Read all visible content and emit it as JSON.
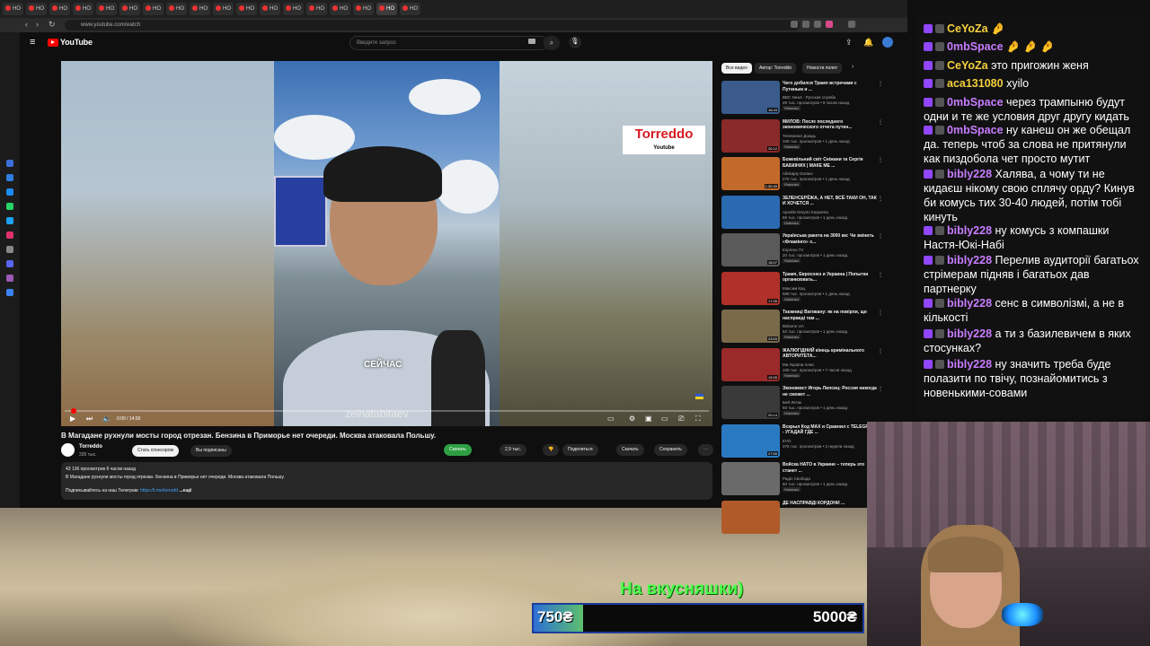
{
  "browser": {
    "tabs": [
      "НО",
      "НО",
      "НО",
      "НО",
      "НО",
      "НО",
      "НО",
      "НО",
      "НО",
      "НО",
      "НО",
      "НО",
      "НО",
      "НО",
      "НО",
      "НО",
      "НО",
      "НО"
    ],
    "url": "www.youtube.com/watch"
  },
  "youtube": {
    "logo": "YouTube",
    "search_placeholder": "Введите запрос",
    "video": {
      "caption": "СЕЙЧАС",
      "watermark": "zeinatabitaev",
      "badge_title": "Torreddo",
      "badge_sub": "Youtube",
      "time": "0:00 / 14:50",
      "progress": 0.01
    },
    "title": "В Магадане рухнули мосты город отрезан. Бензина в Приморье нет очереди. Москва атаковала Польшу.",
    "channel": {
      "name": "Torreddo",
      "subs": "335 тыс."
    },
    "actions": {
      "sponsor": "Стать спонсором",
      "subscribed": "Вы подписаны",
      "download_green": "Скачать",
      "likes": "2,9 тыс.",
      "share": "Поделиться",
      "download": "Скачать",
      "save": "Сохранить"
    },
    "description": {
      "meta": "43 136 просмотров  6 часов назад",
      "line1": "В Магадане рухнули мосты город отрезан. Бензина в Приморье нет очереди. Москва атаковала Польшу.",
      "tg_prefix": "Подписывайтесь на наш Телеграм: ",
      "tg_link": "https://t.me/torredd",
      "more": "...ещё"
    },
    "chips": [
      "Все видео",
      "Автор: Torreddo",
      "Новости полит"
    ],
    "recommendations": [
      {
        "title": "Чего добился Трамп встречами с Путиным и ...",
        "channel": "BBC News - Русская служба",
        "meta": "29 тыс. просмотров • 8 часов назад",
        "tag": "Новинка",
        "dur": "16:43",
        "color": "#3a5b8c"
      },
      {
        "title": "МИЛОВ: После последнего экономического отчета путин...",
        "channel": "Телеканал Дождь",
        "meta": "108 тыс. просмотров • 1 день назад",
        "tag": "Новинка",
        "dur": "30:12",
        "color": "#8a2a2a"
      },
      {
        "title": "Божевільний світ Сніжани та Сергія БАБКІНИХ | МАКЕ МЕ ...",
        "channel": "Alinkajay Duraev",
        "meta": "275 тыс. просмотров • 1 день назад",
        "tag": "Новинка",
        "dur": "1:30:49",
        "color": "#c26a2a"
      },
      {
        "title": "ЗЕЛЕНСЕРЁЖА, А НЕТ, ВСЁ-ТАКИ ОН, ТАК И ХОЧЕТСЯ ...",
        "channel": "Apostle Dmytro Karpenko",
        "meta": "69 тыс. просмотров • 1 день назад",
        "tag": "Новинка",
        "dur": "",
        "color": "#2a6ab0"
      },
      {
        "title": "Українська ракета на 3000 км: Чи змінить «Фламінго» х...",
        "channel": "Espreso.TV",
        "meta": "20 тыс. просмотров • 1 день назад",
        "tag": "Новинка",
        "dur": "16:07",
        "color": "#5a5a5a"
      },
      {
        "title": "Трамп, Евросоюз и Украина | Попытки организовать...",
        "channel": "Максим Кац",
        "meta": "888 тыс. просмотров • 1 день назад",
        "tag": "Новинка",
        "dur": "17:26",
        "color": "#b0302a"
      },
      {
        "title": "Таємниці Ватикану: як на повірпи, що насправді там ...",
        "channel": "Bidsone UA",
        "meta": "52 тыс. просмотров • 1 день назад",
        "tag": "Новинка",
        "dur": "23:53",
        "color": "#7a6a4a"
      },
      {
        "title": "ЖАЛЮГІДНИЙ кінець кримінального АВТОРИТЕТА...",
        "channel": "Ми Україна плюс",
        "meta": "108 тыс. просмотров • 7 часов назад",
        "tag": "Новинка",
        "dur": "15:05",
        "color": "#9a2a2a"
      },
      {
        "title": "Экономист Игорь Липсиц: Россия никогда не сможет ...",
        "channel": "Бей Летак",
        "meta": "93 тыс. просмотров • 1 день назад",
        "tag": "Новинка",
        "dur": "20:14",
        "color": "#3a3a3a"
      },
      {
        "title": "Вскрыл Код MAX и Сравнил с TELEGRAM - УГАДАЙ ГДЕ ...",
        "channel": "EVG",
        "meta": "376 тыс. просмотров • 2 недели назад",
        "tag": "",
        "dur": "27:50",
        "color": "#2a7ac2"
      },
      {
        "title": "Войска НАТО в Украине – теперь это станет ...",
        "channel": "Радіо Свобода",
        "meta": "60 тыс. просмотров • 1 день назад",
        "tag": "Новинка",
        "dur": "",
        "color": "#6a6a6a"
      },
      {
        "title": "ДЕ НАСПРАВДІ КОРДОНИ ...",
        "channel": "",
        "meta": "",
        "tag": "",
        "dur": "",
        "color": "#b05a2a"
      }
    ]
  },
  "chat": [
    {
      "user": "CeYoZa",
      "text": "🤌",
      "color": "#f4d03f"
    },
    {
      "user": "0mbSpace",
      "text": "🤌 🤌 🤌",
      "color": "#c77dff"
    },
    {
      "user": "CeYoZa",
      "text": "это пригожин женя",
      "color": "#f4d03f"
    },
    {
      "user": "aca131080",
      "text": "xyilo",
      "color": "#f4d03f"
    },
    {
      "user": "0mbSpace",
      "text": "через трампыню будут одни и те же условия друг другу кидать",
      "color": "#c77dff"
    },
    {
      "user": "0mbSpace",
      "text": "ну канеш он же обещал да. теперь чтоб за слова не притянули как пиздобола чет просто мутит",
      "color": "#c77dff"
    },
    {
      "user": "bibly228",
      "text": "Халява, а чому ти не кидаєш нікому свою сплячу орду? Кинув би комусь тих 30-40 людей, потім тобі кинуть",
      "color": "#c77dff"
    },
    {
      "user": "bibly228",
      "text": "ну комусь з компашки Настя-Юкі-Набі",
      "color": "#c77dff"
    },
    {
      "user": "bibly228",
      "text": "Перелив аудиторії багатьох стрімерам підняв і багатьох дав партнерку",
      "color": "#c77dff"
    },
    {
      "user": "bibly228",
      "text": "сенс в символізмі, а не в кількості",
      "color": "#c77dff"
    },
    {
      "user": "bibly228",
      "text": "а ти з базилевичем в яких стосунках?",
      "color": "#c77dff"
    },
    {
      "user": "bibly228",
      "text": "ну значить треба буде полазити по твічу, познайомитись з новенькими-совами",
      "color": "#c77dff"
    }
  ],
  "overlay": {
    "text": "На вкусняшки)",
    "goal_current": "750₴",
    "goal_target": "5000₴",
    "goal_progress": 0.15
  }
}
